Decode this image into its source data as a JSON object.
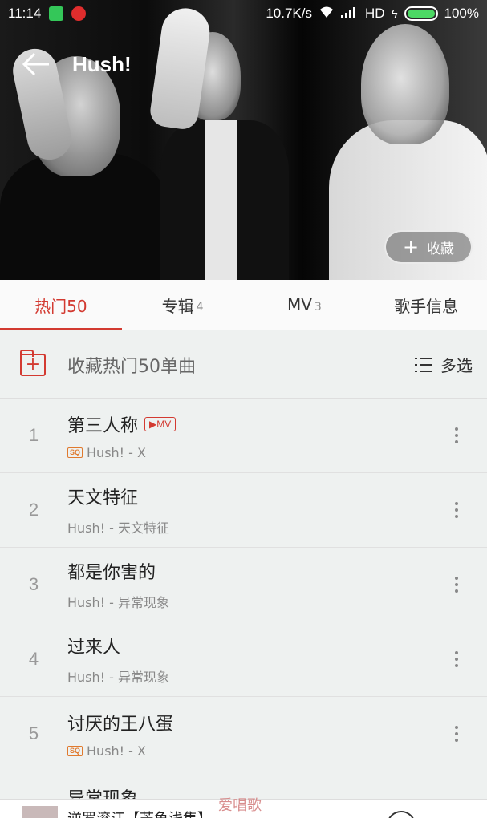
{
  "statusbar": {
    "time": "11:14",
    "network_speed": "10.7K/s",
    "signal": "HD",
    "battery": "100%",
    "battery_level": 1.0
  },
  "header": {
    "title": "Hush!",
    "back_icon": "arrow-left-icon",
    "collect_button": "收藏"
  },
  "tabs": [
    {
      "label": "热门50",
      "count": "",
      "active": true
    },
    {
      "label": "专辑",
      "count": "4",
      "active": false
    },
    {
      "label": "MV",
      "count": "3",
      "active": false
    },
    {
      "label": "歌手信息",
      "count": "",
      "active": false
    }
  ],
  "collect_bar": {
    "label": "收藏热门50单曲",
    "multi_select": "多选"
  },
  "songs": [
    {
      "index": "1",
      "name": "第三人称",
      "mv": "▶MV",
      "sq": "SQ",
      "artist_album": "Hush! - X"
    },
    {
      "index": "2",
      "name": "天文特征",
      "mv": "",
      "sq": "",
      "artist_album": "Hush! - 天文特征"
    },
    {
      "index": "3",
      "name": "都是你害的",
      "mv": "",
      "sq": "",
      "artist_album": "Hush! - 异常现象"
    },
    {
      "index": "4",
      "name": "过来人",
      "mv": "",
      "sq": "",
      "artist_album": "Hush! - 异常现象"
    },
    {
      "index": "5",
      "name": "讨厌的王八蛋",
      "mv": "",
      "sq": "SQ",
      "artist_album": "Hush! - X"
    }
  ],
  "partial_song": "异常现象",
  "mini_player": {
    "title": "逆罗滚江【芒龟浅集】"
  },
  "watermark": "爱唱歌",
  "colors": {
    "accent": "#d33a31",
    "background": "#eef1f0"
  }
}
